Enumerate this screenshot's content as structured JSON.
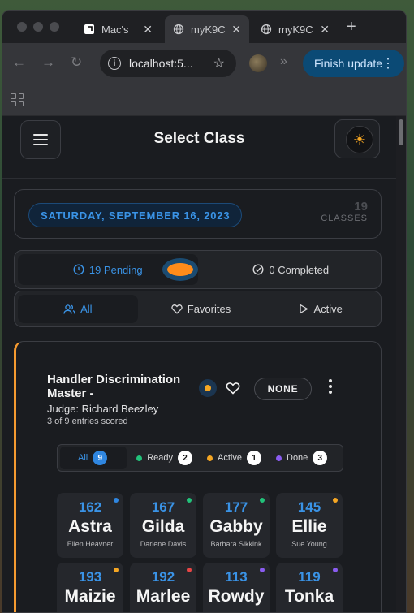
{
  "browser": {
    "tabs": [
      {
        "label": "Mac's",
        "close": "✕"
      },
      {
        "label": "myK9C",
        "close": "✕"
      },
      {
        "label": "myK9C",
        "close": "✕"
      }
    ],
    "new_tab": "+",
    "url": "localhost:5...",
    "update_button": "Finish update"
  },
  "header": {
    "title": "Select Class"
  },
  "trial": {
    "date": "SATURDAY, SEPTEMBER 16, 2023",
    "class_count": "19",
    "class_count_label": "CLASSES"
  },
  "status_tabs": {
    "pending": "19 Pending",
    "completed": "0 Completed"
  },
  "filter_tabs": {
    "all": "All",
    "favorites": "Favorites",
    "active": "Active"
  },
  "class_card": {
    "name": "Handler Discrimination Master -",
    "judge": "Judge: Richard Beezley",
    "scored": "3 of 9 entries scored",
    "badge": "NONE",
    "accent_color": "#f59a30"
  },
  "entry_filter": {
    "all_label": "All",
    "all_count": "9",
    "ready_label": "Ready",
    "ready_count": "2",
    "active_label": "Active",
    "active_count": "1",
    "done_label": "Done",
    "done_count": "3"
  },
  "entries": [
    {
      "armband": "162",
      "dog": "Astra",
      "handler": "Ellen Heavner",
      "status_color": "#2f86e0"
    },
    {
      "armband": "167",
      "dog": "Gilda",
      "handler": "Darlene Davis",
      "status_color": "#22c27a"
    },
    {
      "armband": "177",
      "dog": "Gabby",
      "handler": "Barbara Sikkink",
      "status_color": "#22c27a"
    },
    {
      "armband": "145",
      "dog": "Ellie",
      "handler": "Sue Young",
      "status_color": "#f5a623"
    },
    {
      "armband": "193",
      "dog": "Maizie",
      "handler": "",
      "status_color": "#f5a623"
    },
    {
      "armband": "192",
      "dog": "Marlee",
      "handler": "",
      "status_color": "#e84545"
    },
    {
      "armband": "113",
      "dog": "Rowdy",
      "handler": "",
      "status_color": "#8a5cf0"
    },
    {
      "armband": "119",
      "dog": "Tonka",
      "handler": "",
      "status_color": "#8a5cf0"
    }
  ]
}
